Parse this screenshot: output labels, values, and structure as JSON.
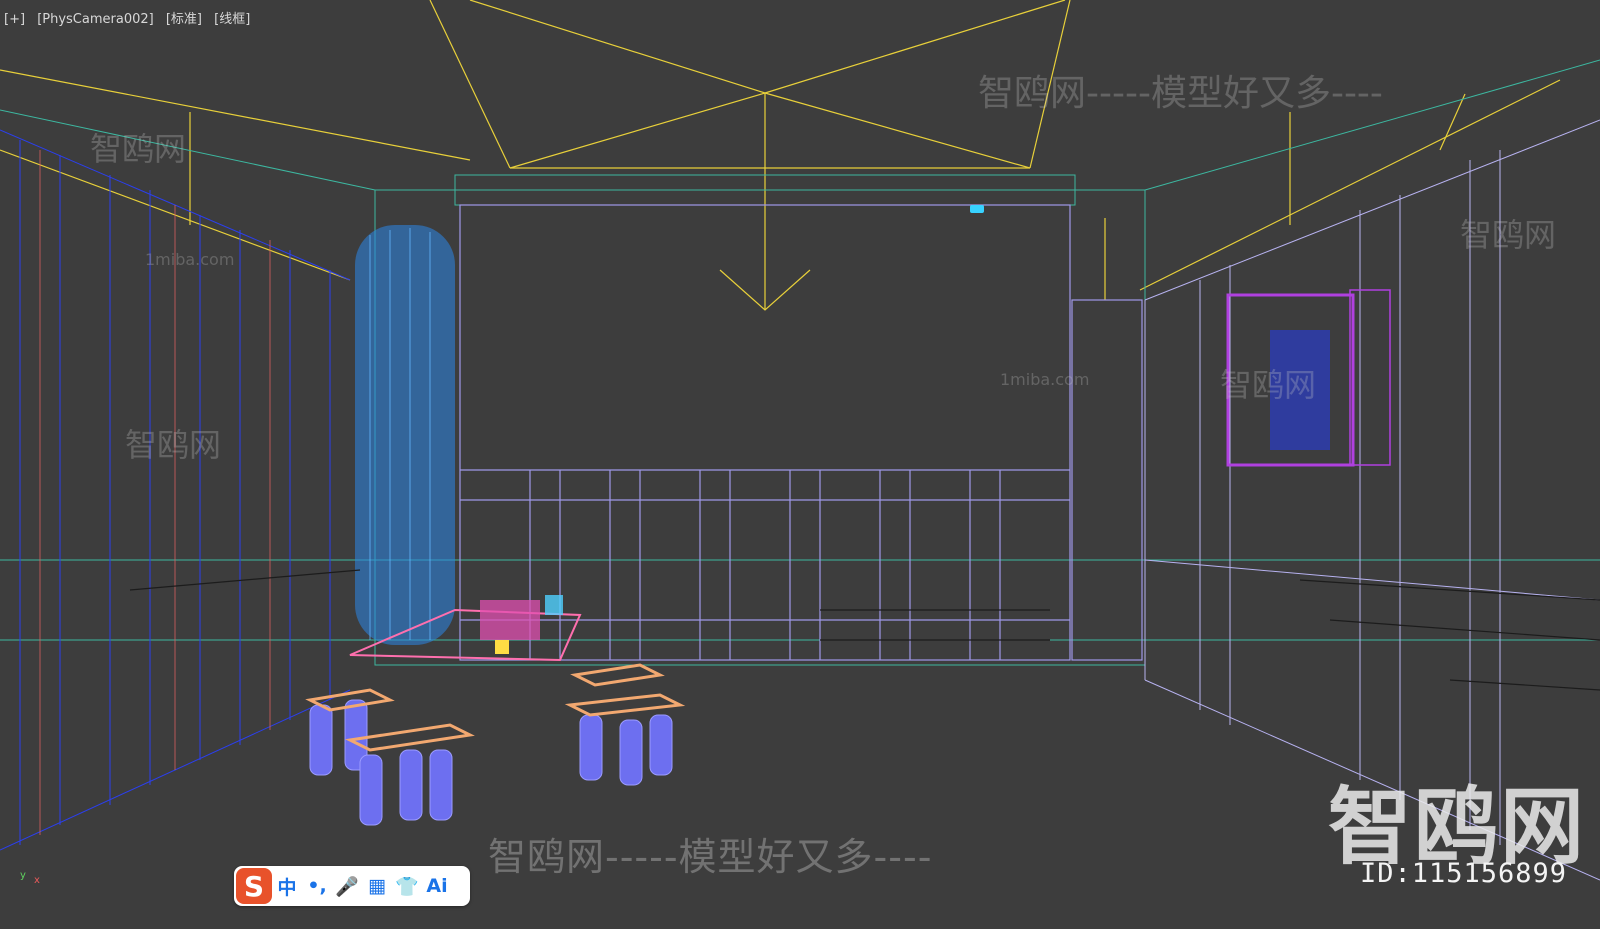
{
  "viewport": {
    "labels": [
      "[+]",
      "[PhysCamera002]",
      "[标准]",
      "[线框]"
    ]
  },
  "watermarks": {
    "main": "智鸥网-----模型好又多----",
    "top": "智鸥网-----模型好又多----",
    "side": "智鸥网",
    "site": "1miba.com"
  },
  "brand": {
    "name": "智鸥网",
    "id": "ID:115156899"
  },
  "ime_toolbar": {
    "logo": "S",
    "items": [
      {
        "name": "chinese-mode",
        "label": "中"
      },
      {
        "name": "punctuation",
        "label": "•,"
      },
      {
        "name": "voice",
        "label": "🎤"
      },
      {
        "name": "keyboard",
        "label": "▦"
      },
      {
        "name": "skin",
        "label": "👕"
      },
      {
        "name": "ai",
        "label": "Ai"
      }
    ]
  },
  "axis": {
    "x": "x",
    "y": "y"
  }
}
